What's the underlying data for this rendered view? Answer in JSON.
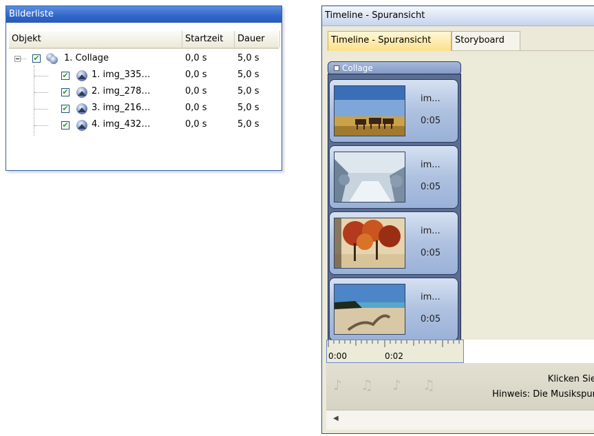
{
  "bilderliste": {
    "title": "Bilderliste",
    "columns": {
      "object": "Objekt",
      "start": "Startzeit",
      "duration": "Dauer"
    },
    "rows": [
      {
        "label": "1. Collage",
        "start": "0,0 s",
        "duration": "5,0 s"
      },
      {
        "label": "1. img_335…",
        "start": "0,0 s",
        "duration": "5,0 s"
      },
      {
        "label": "2. img_278…",
        "start": "0,0 s",
        "duration": "5,0 s"
      },
      {
        "label": "3. img_216…",
        "start": "0,0 s",
        "duration": "5,0 s"
      },
      {
        "label": "4. img_432…",
        "start": "0,0 s",
        "duration": "5,0 s"
      }
    ]
  },
  "timeline": {
    "window_title": "Timeline - Spuransicht",
    "tabs": [
      {
        "label": "Timeline - Spuransicht",
        "active": true
      },
      {
        "label": "Storyboard",
        "active": false
      }
    ],
    "group_label": "Collage",
    "clips": [
      {
        "name": "im...",
        "duration": "0:05"
      },
      {
        "name": "im...",
        "duration": "0:05"
      },
      {
        "name": "im...",
        "duration": "0:05"
      },
      {
        "name": "im...",
        "duration": "0:05"
      }
    ],
    "ruler": {
      "tick1": "0:00",
      "tick2": "0:02"
    },
    "music_hint_line1": "Klicken Sie",
    "music_hint_line2": "Hinweis: Die Musikspur"
  },
  "colors": {
    "accent_blue": "#2f66c9",
    "tab_active": "#fbe08c",
    "clip_blue": "#aec1e0"
  }
}
